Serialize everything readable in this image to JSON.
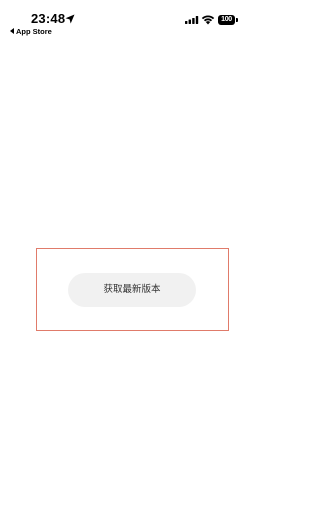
{
  "status_bar": {
    "time": "23:48",
    "back_label": "App Store",
    "battery_level": "100",
    "icons": [
      "location-arrow-icon",
      "signal-icon",
      "wifi-icon",
      "battery-icon"
    ]
  },
  "colors": {
    "panel_border": "#e07b6a",
    "button_background": "#f1f1f1",
    "button_text": "#333333"
  },
  "main": {
    "update_button_label": "获取最新版本"
  }
}
